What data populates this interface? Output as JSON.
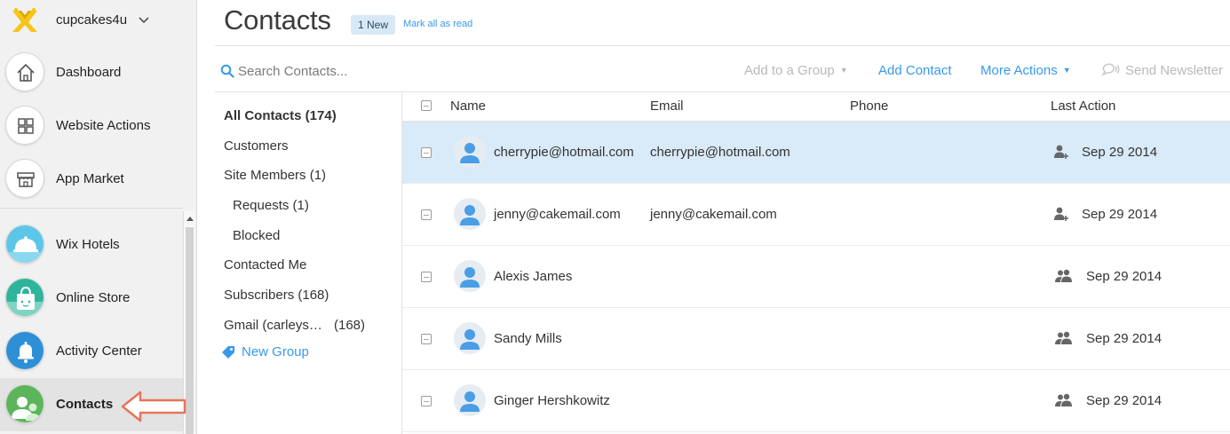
{
  "sidebar": {
    "site_name": "cupcakes4u",
    "nav_items": [
      {
        "label": "Dashboard",
        "icon": "home-icon"
      },
      {
        "label": "Website Actions",
        "icon": "grid-icon"
      },
      {
        "label": "App Market",
        "icon": "store-icon"
      },
      {
        "label": "Wix Hotels",
        "icon": "hotel-bell-icon"
      },
      {
        "label": "Online Store",
        "icon": "shopping-bag-icon"
      },
      {
        "label": "Activity Center",
        "icon": "bell-icon"
      },
      {
        "label": "Contacts",
        "icon": "contacts-icon"
      }
    ],
    "active_item": "Contacts"
  },
  "header": {
    "title": "Contacts",
    "badge": "1 New",
    "mark_all_read": "Mark all as read"
  },
  "toolbar": {
    "search_placeholder": "Search Contacts...",
    "add_to_group": "Add to a Group",
    "add_contact": "Add Contact",
    "more_actions": "More Actions",
    "send_newsletter": "Send Newsletter"
  },
  "groups": {
    "items": [
      {
        "label": "All Contacts (174)"
      },
      {
        "label": "Customers"
      },
      {
        "label": "Site Members (1)"
      },
      {
        "label": "Requests (1)"
      },
      {
        "label": "Blocked"
      },
      {
        "label": "Contacted Me"
      },
      {
        "label": "Subscribers (168)"
      },
      {
        "label": "Gmail (carleys…",
        "count": "(168)"
      }
    ],
    "new_group": "New Group"
  },
  "table": {
    "columns": [
      "Name",
      "Email",
      "Phone",
      "Last Action"
    ],
    "rows": [
      {
        "name": "cherrypie@hotmail.com",
        "email": "cherrypie@hotmail.com",
        "phone": "",
        "last_action": "Sep 29 2014",
        "action_icon": "add-person-icon",
        "selected": true
      },
      {
        "name": "jenny@cakemail.com",
        "email": "jenny@cakemail.com",
        "phone": "",
        "last_action": "Sep 29 2014",
        "action_icon": "add-person-icon",
        "selected": false
      },
      {
        "name": "Alexis James",
        "email": "",
        "phone": "",
        "last_action": "Sep 29 2014",
        "action_icon": "group-icon",
        "selected": false
      },
      {
        "name": "Sandy Mills",
        "email": "",
        "phone": "",
        "last_action": "Sep 29 2014",
        "action_icon": "group-icon",
        "selected": false
      },
      {
        "name": "Ginger Hershkowitz",
        "email": "",
        "phone": "",
        "last_action": "Sep 29 2014",
        "action_icon": "group-icon",
        "selected": false
      }
    ]
  },
  "colors": {
    "accent": "#3899ec",
    "selected_row": "#d9eaf8",
    "badge_bg": "#d9e8f5",
    "annotation_arrow": "#e8745a"
  }
}
